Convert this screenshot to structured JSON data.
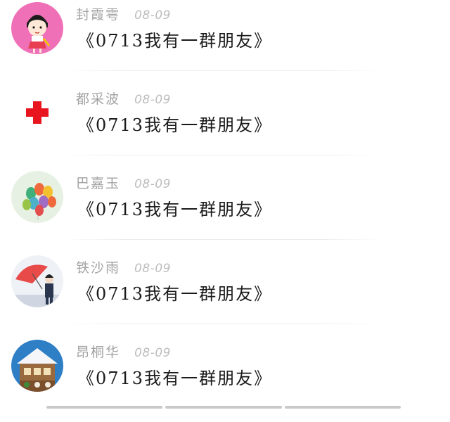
{
  "items": [
    {
      "name": "封霞雩",
      "date": "08-09",
      "title": "《0713我有一群朋友》",
      "avatar": "cartoon-girl-avatar"
    },
    {
      "name": "都采波",
      "date": "08-09",
      "title": "《0713我有一群朋友》",
      "avatar": "red-cross-avatar"
    },
    {
      "name": "巴嘉玉",
      "date": "08-09",
      "title": "《0713我有一群朋友》",
      "avatar": "balloons-avatar"
    },
    {
      "name": "铁沙雨",
      "date": "08-09",
      "title": "《0713我有一群朋友》",
      "avatar": "umbrella-person-avatar"
    },
    {
      "name": "昂桐华",
      "date": "08-09",
      "title": "《0713我有一群朋友》",
      "avatar": "house-avatar"
    }
  ]
}
